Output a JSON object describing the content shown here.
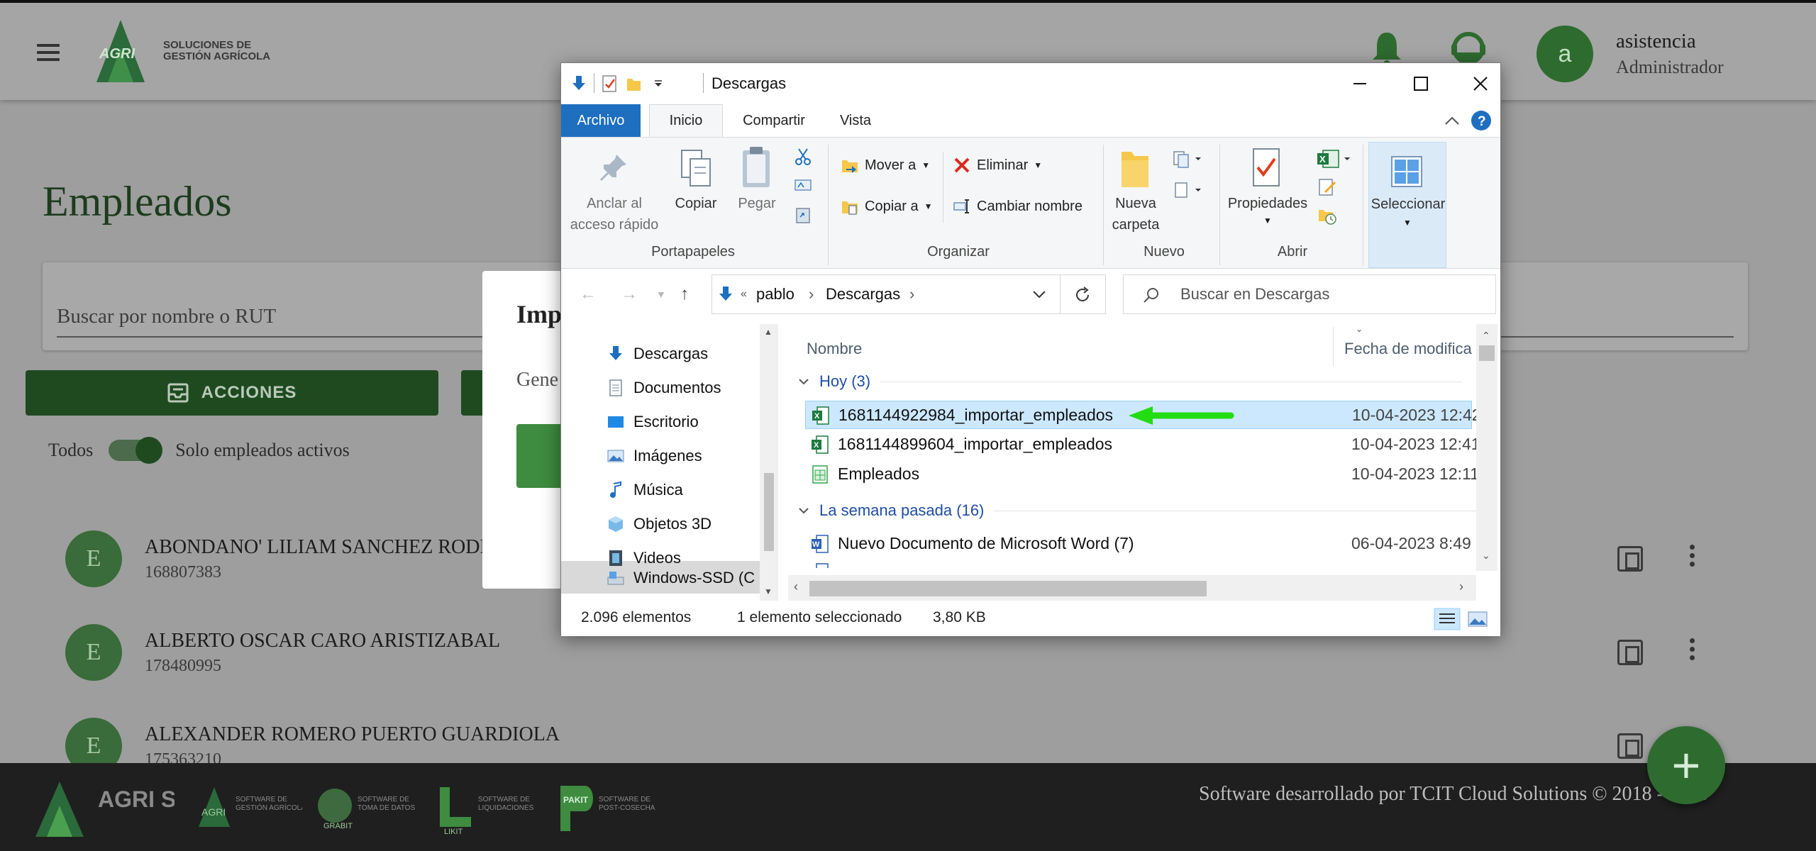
{
  "app": {
    "logo_text_line1": "SOLUCIONES DE",
    "logo_text_line2": "GESTIÓN AGRÍCOLA",
    "logo_mark": "AGRI",
    "user_initial": "a",
    "user_name": "asistencia",
    "user_role": "Administrador",
    "page_title": "Empleados",
    "search_placeholder": "Buscar por nombre o RUT",
    "actions_label": "ACCIONES",
    "toggle_left": "Todos",
    "toggle_right": "Solo empleados activos",
    "toggle_on": true,
    "employees": [
      {
        "initial": "E",
        "name": "ABONDANO' LILIAM SANCHEZ RODR",
        "rut": "168807383"
      },
      {
        "initial": "E",
        "name": "ALBERTO OSCAR CARO ARISTIZABAL",
        "rut": "178480995"
      },
      {
        "initial": "E",
        "name": "ALEXANDER ROMERO PUERTO GUARDIOLA",
        "rut": "175363210"
      }
    ],
    "modal_title": "Imp",
    "modal_text": "Gene",
    "footer_text": "Software desarrollado por TCIT Cloud Solutions © 2018 - 2023",
    "footer_logos": [
      "AGRI SUITE",
      "AGRI",
      "GRABIT",
      "LIKIT",
      "PAKIT"
    ],
    "fab_label": "+",
    "colors": {
      "brand_green": "#2e6b2f",
      "dark_green": "#1f4a20",
      "footer": "#1f1f1f"
    }
  },
  "explorer": {
    "title": "Descargas",
    "tabs": {
      "file": "Archivo",
      "home": "Inicio",
      "share": "Compartir",
      "view": "Vista"
    },
    "ribbon": {
      "pin_line1": "Anclar al",
      "pin_line2": "acceso rápido",
      "copy": "Copiar",
      "paste": "Pegar",
      "clipboard_group": "Portapapeles",
      "move_to": "Mover a",
      "copy_to": "Copiar a",
      "delete": "Eliminar",
      "rename": "Cambiar nombre",
      "organize_group": "Organizar",
      "new_folder_line1": "Nueva",
      "new_folder_line2": "carpeta",
      "new_group": "Nuevo",
      "properties": "Propiedades",
      "open_group": "Abrir",
      "select": "Seleccionar"
    },
    "breadcrumb": [
      "pablo",
      "Descargas"
    ],
    "breadcrumb_prefix": "«",
    "search_placeholder": "Buscar en Descargas",
    "nav_items": [
      {
        "label": "Descargas",
        "icon": "download-folder-icon"
      },
      {
        "label": "Documentos",
        "icon": "documents-icon"
      },
      {
        "label": "Escritorio",
        "icon": "desktop-icon"
      },
      {
        "label": "Imágenes",
        "icon": "pictures-icon"
      },
      {
        "label": "Música",
        "icon": "music-icon"
      },
      {
        "label": "Objetos 3D",
        "icon": "objects-3d-icon"
      },
      {
        "label": "Videos",
        "icon": "videos-icon"
      },
      {
        "label": "Windows-SSD (C",
        "icon": "drive-icon"
      }
    ],
    "columns": {
      "name": "Nombre",
      "date": "Fecha de modifica"
    },
    "groups": [
      {
        "label": "Hoy (3)",
        "files": [
          {
            "name": "1681144922984_importar_empleados",
            "date": "10-04-2023 12:42",
            "type": "excel",
            "selected": true
          },
          {
            "name": "1681144899604_importar_empleados",
            "date": "10-04-2023 12:41",
            "type": "excel",
            "selected": false
          },
          {
            "name": "Empleados",
            "date": "10-04-2023 12:11",
            "type": "sheet",
            "selected": false
          }
        ]
      },
      {
        "label": "La semana pasada (16)",
        "files": [
          {
            "name": "Nuevo Documento de Microsoft Word (7)",
            "date": "06-04-2023 8:49",
            "type": "word",
            "selected": false
          }
        ]
      }
    ],
    "status_count": "2.096 elementos",
    "status_selected": "1 elemento seleccionado",
    "status_size": "3,80 KB",
    "annotation_arrow_color": "#22dd11"
  }
}
